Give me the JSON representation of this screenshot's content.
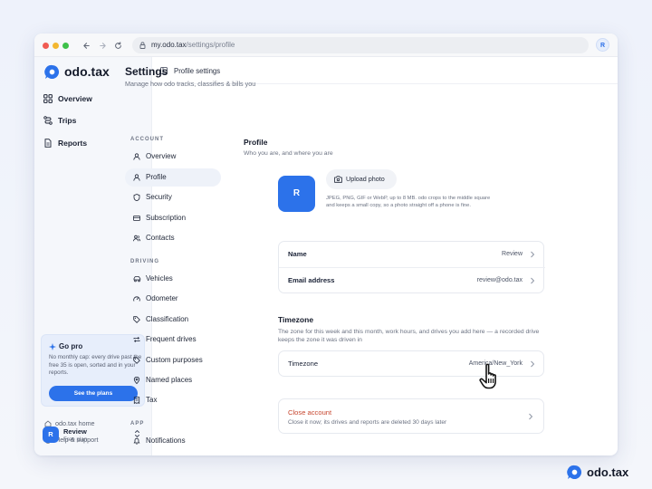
{
  "browser": {
    "url_host": "my.odo.tax",
    "url_path": "/settings/profile",
    "back_icon": "arrow-left-icon",
    "forward_icon": "arrow-right-icon",
    "reload_icon": "reload-icon",
    "avatar_initial": "R"
  },
  "brand": {
    "name": "odo.tax",
    "color": "#2c72ea"
  },
  "sidebar": {
    "items": [
      {
        "label": "Overview",
        "icon": "grid-icon"
      },
      {
        "label": "Trips",
        "icon": "route-icon"
      },
      {
        "label": "Reports",
        "icon": "document-icon"
      }
    ],
    "promo": {
      "title": "Go pro",
      "text": "No monthly cap: every drive past the free 35 is open, sorted and in your reports.",
      "button": "See the plans"
    },
    "links": [
      {
        "label": "odo.tax home",
        "icon": "home-icon"
      },
      {
        "label": "Help & support",
        "icon": "help-icon"
      }
    ],
    "user": {
      "initial": "R",
      "name": "Review",
      "plan": "Free plan"
    }
  },
  "topbar": {
    "title": "Profile settings"
  },
  "page": {
    "title": "Settings",
    "subtitle": "Manage how odo tracks, classifies & bills you"
  },
  "settings_nav": {
    "account_label": "ACCOUNT",
    "account": [
      {
        "label": "Overview",
        "icon": "user-icon"
      },
      {
        "label": "Profile",
        "icon": "user-icon",
        "active": true
      },
      {
        "label": "Security",
        "icon": "shield-icon"
      },
      {
        "label": "Subscription",
        "icon": "card-icon"
      },
      {
        "label": "Contacts",
        "icon": "users-icon"
      }
    ],
    "driving_label": "DRIVING",
    "driving": [
      {
        "label": "Vehicles",
        "icon": "car-icon"
      },
      {
        "label": "Odometer",
        "icon": "gauge-icon"
      },
      {
        "label": "Classification",
        "icon": "tag-icon"
      },
      {
        "label": "Frequent drives",
        "icon": "repeat-icon"
      },
      {
        "label": "Custom purposes",
        "icon": "tag-icon"
      },
      {
        "label": "Named places",
        "icon": "pin-icon"
      },
      {
        "label": "Tax",
        "icon": "receipt-icon"
      }
    ],
    "app_label": "APP",
    "app": [
      {
        "label": "Notifications",
        "icon": "bell-icon"
      }
    ]
  },
  "profile": {
    "title": "Profile",
    "subtitle": "Who you are, and where you are",
    "avatar_initial": "R",
    "upload_label": "Upload photo",
    "upload_hint": "JPEG, PNG, GIF or WebP, up to 8 MB. odo crops to the middle square and keeps a small copy, so a photo straight off a phone is fine.",
    "fields": [
      {
        "label": "Name",
        "value": "Review"
      },
      {
        "label": "Email address",
        "value": "review@odo.tax"
      }
    ]
  },
  "timezone": {
    "title": "Timezone",
    "subtitle": "The zone for this week and this month, work hours, and drives you add here — a recorded drive keeps the zone it was driven in",
    "label": "Timezone",
    "value": "America/New_York"
  },
  "close_account": {
    "title": "Close account",
    "subtitle": "Close it now; its drives and reports are deleted 30 days later",
    "color": "#c7472f"
  }
}
